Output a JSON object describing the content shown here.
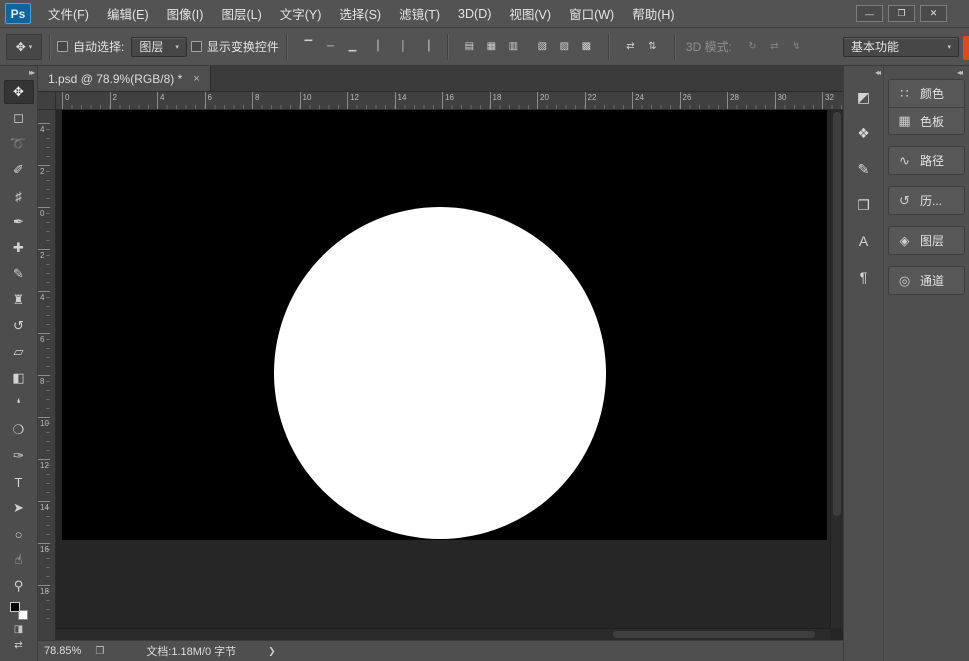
{
  "colors": {
    "ui_gray": "#535353",
    "pasteboard": "#262626",
    "document_bg": "#000000",
    "circle_fill": "#ffffff",
    "accent_artifact": "#e0481e"
  },
  "window": {
    "logo": "Ps",
    "menus": [
      "文件(F)",
      "编辑(E)",
      "图像(I)",
      "图层(L)",
      "文字(Y)",
      "选择(S)",
      "滤镜(T)",
      "3D(D)",
      "视图(V)",
      "窗口(W)",
      "帮助(H)"
    ],
    "controls": {
      "minimize": "—",
      "restore": "❐",
      "close": "✕"
    }
  },
  "options": {
    "tool_glyph": "✥",
    "tool_arrow": "▾",
    "auto_select": {
      "label": "自动选择:",
      "value": "图层",
      "arrow": "▾"
    },
    "show_transform": {
      "label": "显示变换控件"
    },
    "align": {
      "g1": [
        "▔",
        "─",
        "▁"
      ],
      "g2": [
        "▏",
        "│",
        "▕"
      ],
      "g3": [
        "▤",
        "▦",
        "▥"
      ],
      "g4": [
        "▧",
        "▨",
        "▩"
      ],
      "g5": [
        "⇄",
        "⇅"
      ]
    },
    "mode": {
      "label": "3D 模式:",
      "icons": [
        "↻",
        "⇄",
        "↯"
      ]
    },
    "workspace": {
      "value": "基本功能",
      "arrow": "▾"
    }
  },
  "toolbar": {
    "chevron": "▸▸",
    "tools": [
      {
        "name": "move-tool",
        "glyph": "✥"
      },
      {
        "name": "rectangular-marquee-tool",
        "glyph": "◻"
      },
      {
        "name": "lasso-tool",
        "glyph": "➰"
      },
      {
        "name": "quick-selection-tool",
        "glyph": "✐"
      },
      {
        "name": "crop-tool",
        "glyph": "♯"
      },
      {
        "name": "eyedropper-tool",
        "glyph": "✒"
      },
      {
        "name": "healing-brush-tool",
        "glyph": "✚"
      },
      {
        "name": "brush-tool",
        "glyph": "✎"
      },
      {
        "name": "clone-stamp-tool",
        "glyph": "♜"
      },
      {
        "name": "history-brush-tool",
        "glyph": "↺"
      },
      {
        "name": "eraser-tool",
        "glyph": "▱"
      },
      {
        "name": "gradient-tool",
        "glyph": "◧"
      },
      {
        "name": "blur-tool",
        "glyph": "❛"
      },
      {
        "name": "dodge-tool",
        "glyph": "❍"
      },
      {
        "name": "pen-tool",
        "glyph": "✑"
      },
      {
        "name": "type-tool",
        "glyph": "T"
      },
      {
        "name": "path-selection-tool",
        "glyph": "➤"
      },
      {
        "name": "ellipse-tool",
        "glyph": "○"
      },
      {
        "name": "hand-tool",
        "glyph": "☝"
      },
      {
        "name": "zoom-tool",
        "glyph": "⚲"
      }
    ],
    "footer": {
      "quick_mask": "◨",
      "screen_mode": "⇄"
    }
  },
  "tab": {
    "title": "1.psd @ 78.9%(RGB/8) *",
    "close": "×"
  },
  "rulers": {
    "horizontal": [
      "0",
      "2",
      "4",
      "6",
      "8",
      "10",
      "12",
      "14",
      "16",
      "18",
      "20",
      "22",
      "24",
      "26",
      "28",
      "30",
      "32"
    ],
    "vertical": [
      "4",
      "2",
      "0",
      "2",
      "4",
      "6",
      "8",
      "10",
      "12",
      "14",
      "16",
      "18"
    ]
  },
  "dock": {
    "collapse_chevron": "◂◂",
    "icon_buttons": [
      {
        "name": "adjustments-panel-icon",
        "glyph": "◩"
      },
      {
        "name": "styles-panel-icon",
        "glyph": "❖"
      },
      {
        "name": "brush-presets-panel-icon",
        "glyph": "✎"
      },
      {
        "name": "clone-source-panel-icon",
        "glyph": "❐"
      },
      {
        "name": "character-panel-icon",
        "glyph": "A"
      },
      {
        "name": "paragraph-panel-icon",
        "glyph": "¶"
      }
    ],
    "panels": [
      {
        "label": "颜色",
        "glyph": "∷"
      },
      {
        "label": "色板",
        "glyph": "▦"
      },
      {
        "label": "路径",
        "glyph": "∿"
      },
      {
        "label": "历...",
        "glyph": "↺"
      },
      {
        "label": "图层",
        "glyph": "◈"
      },
      {
        "label": "通道",
        "glyph": "◎"
      }
    ]
  },
  "status": {
    "zoom": "78.85%",
    "flyout_glyph": "❐",
    "doc_info": "文档:1.18M/0 字节",
    "chevron": "❯"
  }
}
